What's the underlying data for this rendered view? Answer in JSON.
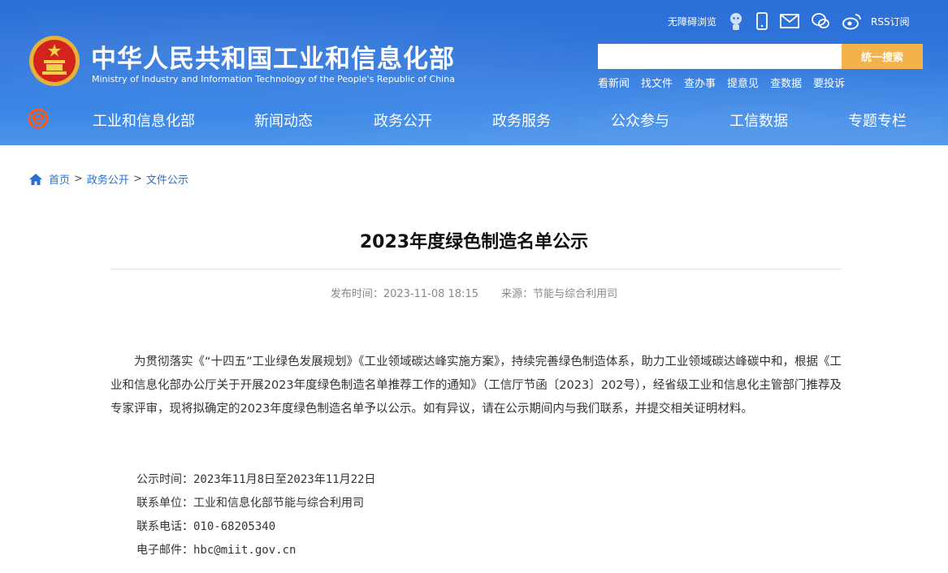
{
  "header": {
    "title_cn": "中华人民共和国工业和信息化部",
    "title_en": "Ministry of Industry and Information Technology of the People's Republic of China",
    "accessibility": "无障碍浏览",
    "rss": "RSS订阅",
    "search_placeholder": "",
    "search_button": "统一搜索",
    "quick_links": [
      "看新闻",
      "找文件",
      "查办事",
      "提意见",
      "查数据",
      "要投诉"
    ]
  },
  "nav": {
    "items": [
      "工业和信息化部",
      "新闻动态",
      "政务公开",
      "政务服务",
      "公众参与",
      "工信数据",
      "专题专栏"
    ]
  },
  "breadcrumb": {
    "home": "首页",
    "items": [
      "政务公开",
      "文件公示"
    ],
    "separator": ">"
  },
  "article": {
    "title": "2023年度绿色制造名单公示",
    "publish_label": "发布时间：2023-11-08 18:15",
    "source_label": "来源：节能与综合利用司",
    "paragraph": "为贯彻落实《“十四五”工业绿色发展规划》《工业领域碳达峰实施方案》，持续完善绿色制造体系，助力工业领域碳达峰碳中和，根据《工业和信息化部办公厅关于开展2023年度绿色制造名单推荐工作的通知》（工信厅节函〔2023〕202号），经省级工业和信息化主管部门推荐及专家评审，现将拟确定的2023年度绿色制造名单予以公示。如有异议，请在公示期间内与我们联系，并提交相关证明材料。",
    "info": [
      "公示时间：2023年11月8日至2023年11月22日",
      "联系单位：工业和信息化部节能与综合利用司",
      "联系电话：010-68205340",
      "电子邮件：hbc@miit.gov.cn"
    ]
  },
  "colors": {
    "header_blue": "#2f76dc",
    "search_button": "#f3b24b",
    "link_blue": "#2a6fd1"
  }
}
